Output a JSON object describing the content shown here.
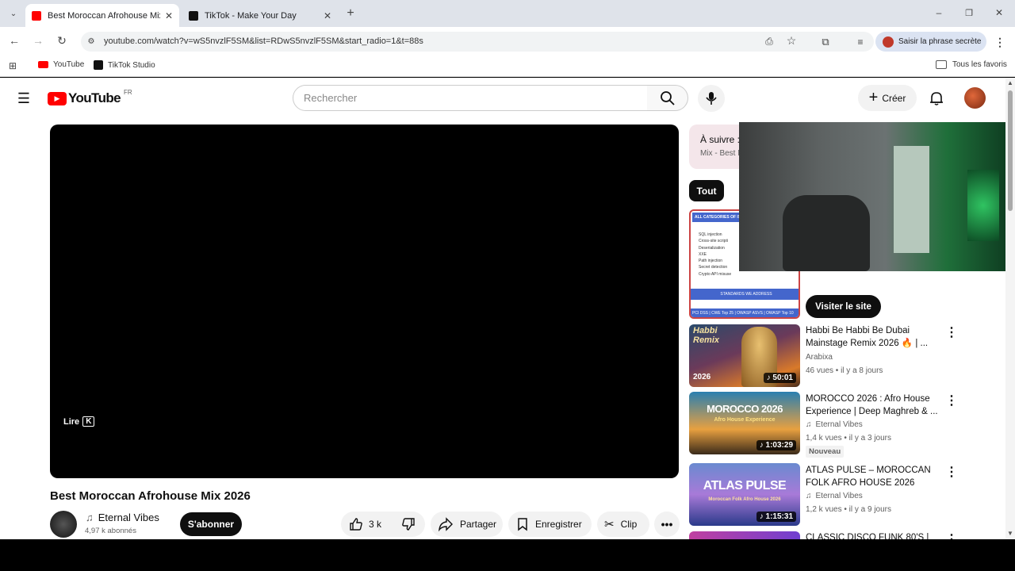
{
  "browser": {
    "tabs": [
      {
        "title": "Best Moroccan Afrohouse Mix",
        "active": true
      },
      {
        "title": "TikTok - Make Your Day",
        "active": false
      }
    ],
    "url": "youtube.com/watch?v=wS5nvzlF5SM&list=RDwS5nvzlF5SM&start_radio=1&t=88s",
    "profile_label": "Saisir la phrase secrète",
    "bookmarks": [
      {
        "label": "YouTube"
      },
      {
        "label": "TikTok Studio"
      }
    ],
    "all_bookmarks": "Tous les favoris"
  },
  "youtube": {
    "logo_text": "YouTube",
    "region": "FR",
    "search_placeholder": "Rechercher",
    "create_label": "Créer"
  },
  "player": {
    "play_label": "Lire",
    "play_key": "K"
  },
  "video": {
    "title": "Best Moroccan Afrohouse Mix 2026",
    "channel": "Eternal Vibes",
    "subscribers": "4,97 k abonnés",
    "subscribe_label": "S'abonner",
    "likes": "3 k",
    "share_label": "Partager",
    "save_label": "Enregistrer",
    "clip_label": "Clip"
  },
  "sidebar": {
    "up_next_label": "À suivre :",
    "up_next_sub": "Mix - Best M",
    "chip_all": "Tout",
    "visit_site": "Visiter le site",
    "ad_header": "ALL CATEGORIES OF ISSUES",
    "ad_items": [
      "SQL injection",
      "Cross-site scripti",
      "Deserialization",
      "XXE",
      "Path injection",
      "Secret detection",
      "Crypto API misuse"
    ],
    "ad_footer_title": "STANDARDS WE ADDRESS",
    "ad_footer_text": "PCI DSS | CWE Top 25 | OWASP ASVS | OWASP Top 10",
    "videos": [
      {
        "title": "Habbi Be Habbi Be Dubai Mainstage Remix 2026 🔥 | ...",
        "channel": "Arabixa",
        "meta": "46 vues • il y a 8 jours",
        "duration": "50:01",
        "thumb_text": "Habbi Remix",
        "thumb_year": "2026",
        "badge": ""
      },
      {
        "title": "MOROCCO 2026 : Afro House Experience | Deep Maghreb & ...",
        "channel": "Eternal Vibes",
        "meta": "1,4 k vues • il y a 3 jours",
        "duration": "1:03:29",
        "thumb_text": "MOROCCO 2026",
        "thumb_sub": "Afro House Experience",
        "badge": "Nouveau"
      },
      {
        "title": "ATLAS PULSE – MOROCCAN FOLK AFRO HOUSE 2026",
        "channel": "Eternal Vibes",
        "meta": "1,2 k vues • il y a 9 jours",
        "duration": "1:15:31",
        "thumb_text": "ATLAS PULSE",
        "thumb_sub": "Moroccan Folk Afro House 2026",
        "badge": ""
      },
      {
        "title": "CLASSIC DISCO FUNK 80'S |",
        "channel": "",
        "meta": "",
        "duration": "",
        "badge": ""
      }
    ]
  }
}
